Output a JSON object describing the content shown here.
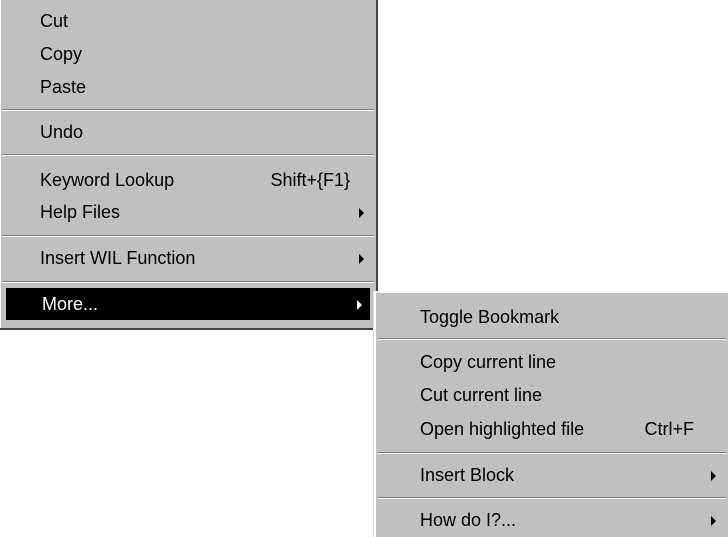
{
  "main_menu": {
    "cut": "Cut",
    "copy": "Copy",
    "paste": "Paste",
    "undo": "Undo",
    "keyword_lookup": "Keyword Lookup",
    "keyword_lookup_shortcut": "Shift+{F1}",
    "help_files": "Help Files",
    "insert_wil_function": "Insert WIL Function",
    "more": "More..."
  },
  "more_submenu": {
    "toggle_bookmark": "Toggle Bookmark",
    "copy_current_line": "Copy current line",
    "cut_current_line": "Cut current line",
    "open_highlighted_file": "Open highlighted file",
    "open_highlighted_file_shortcut": "Ctrl+F",
    "insert_block": "Insert Block",
    "how_do_i": "How do I?..."
  },
  "colors": {
    "menu_bg": "#c0c0c0",
    "highlight_bg": "#000000",
    "highlight_text": "#ffffff"
  },
  "icons": [
    "submenu-arrow-icon"
  ]
}
